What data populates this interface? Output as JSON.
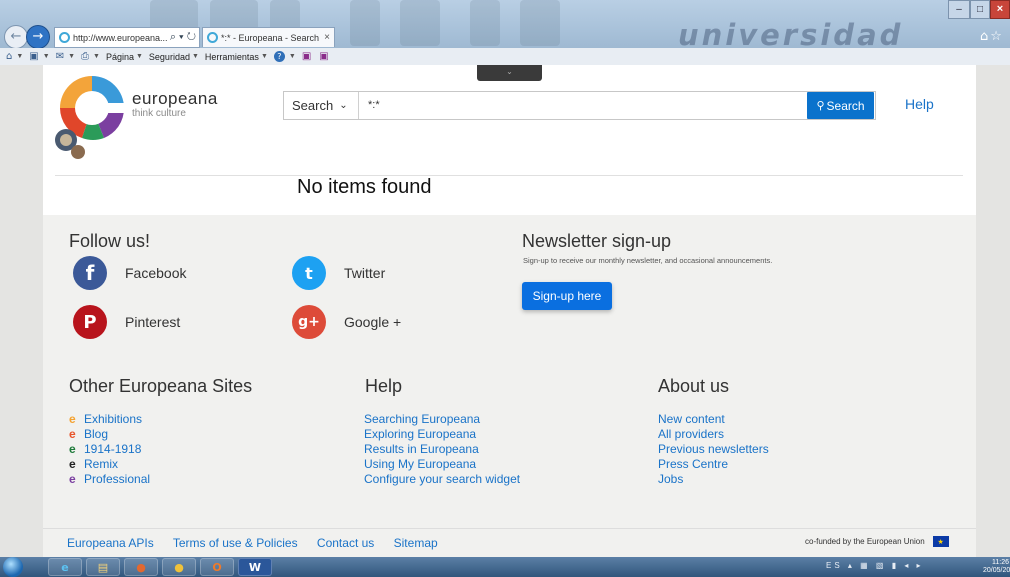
{
  "browser": {
    "address_url": "http://www.europeana...",
    "address_tools": "⌕ ▾ ↻",
    "tab_title": "*:* - Europeana - Search res...",
    "tab_close": "×",
    "title_deco_text": "universidad",
    "command_bar": [
      {
        "icon": "⌂",
        "label": ""
      },
      {
        "icon": "▣",
        "label": ""
      },
      {
        "icon": "✉",
        "label": ""
      },
      {
        "icon": "⎙",
        "label": ""
      },
      {
        "icon": "",
        "label": "Página"
      },
      {
        "icon": "",
        "label": "Seguridad"
      },
      {
        "icon": "",
        "label": "Herramientas"
      },
      {
        "icon": "?",
        "label": ""
      }
    ]
  },
  "header": {
    "logo_name": "europeana",
    "logo_tagline": "think culture",
    "search_scope": "Search",
    "search_query": "*:*",
    "search_button": "Search",
    "help_link": "Help"
  },
  "results": {
    "message": "No items found"
  },
  "follow": {
    "heading": "Follow us!",
    "items": [
      {
        "label": "Facebook",
        "glyph": "f",
        "color": "#3b5998"
      },
      {
        "label": "Twitter",
        "glyph": "t",
        "color": "#1da1f2"
      },
      {
        "label": "Pinterest",
        "glyph": "P",
        "color": "#b8141c"
      },
      {
        "label": "Google +",
        "glyph": "g+",
        "color": "#dd4b39"
      }
    ]
  },
  "newsletter": {
    "heading": "Newsletter sign-up",
    "subtext": "Sign-up to receive our monthly newsletter, and occasional announcements.",
    "button": "Sign-up here"
  },
  "other_sites": {
    "heading": "Other Europeana Sites",
    "items": [
      {
        "label": "Exhibitions",
        "color": "#f4a230"
      },
      {
        "label": "Blog",
        "color": "#e8542a"
      },
      {
        "label": "1914-1918",
        "color": "#1e7a3a"
      },
      {
        "label": "Remix",
        "color": "#222222"
      },
      {
        "label": "Professional",
        "color": "#7b3fa0"
      }
    ]
  },
  "help": {
    "heading": "Help",
    "items": [
      "Searching Europeana",
      "Exploring Europeana",
      "Results in Europeana",
      "Using My Europeana",
      "Configure your search widget"
    ]
  },
  "about": {
    "heading": "About us",
    "items": [
      "New content",
      "All providers",
      "Previous newsletters",
      "Press Centre",
      "Jobs"
    ]
  },
  "footer": {
    "links": [
      "Europeana APIs",
      "Terms of use & Policies",
      "Contact us",
      "Sitemap"
    ],
    "cofunded": "co-funded by the European Union"
  },
  "taskbar": {
    "apps": [
      "e",
      "▤",
      "●",
      "●",
      "O",
      "W"
    ],
    "tray": "ES ▴ ▦ ▧ ▮ ◂ ▸",
    "time": "11:26",
    "date": "20/05/2015"
  }
}
